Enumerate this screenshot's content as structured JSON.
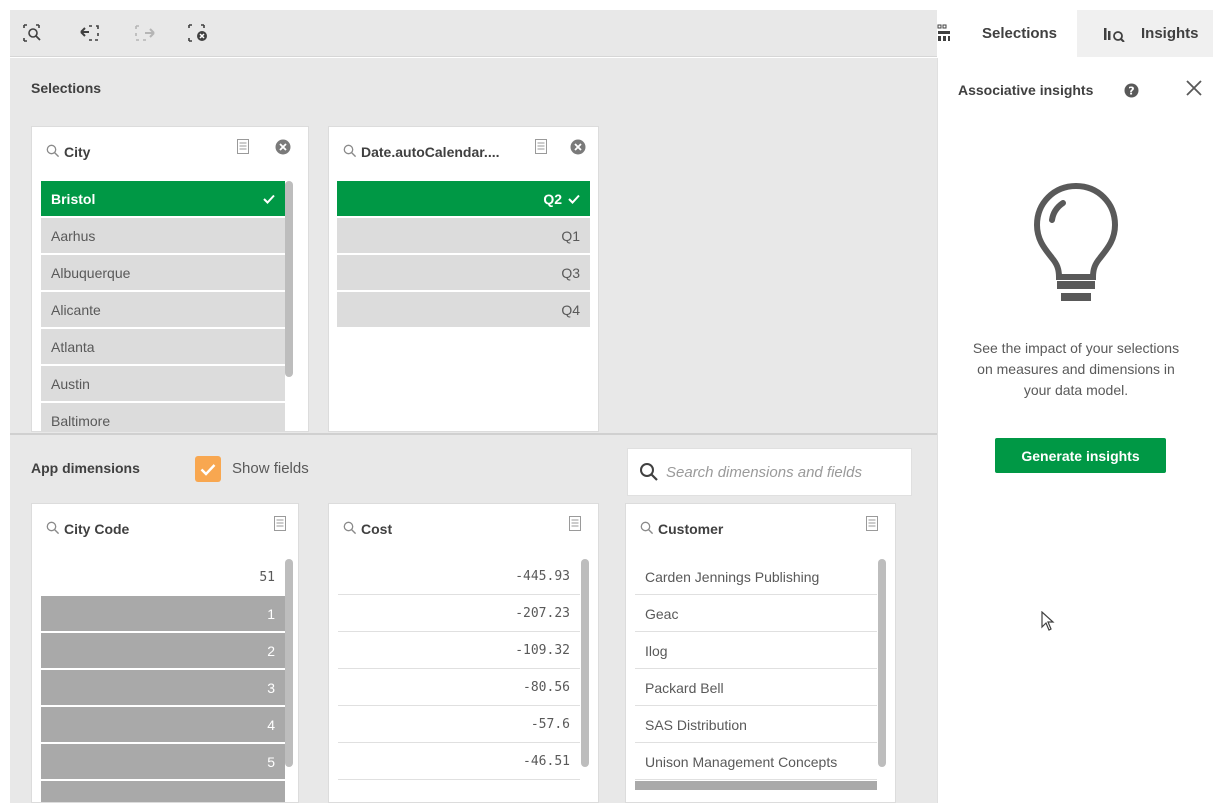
{
  "toolbar": {
    "buttons": [
      "smart-search-icon",
      "step-back-icon",
      "step-forward-icon",
      "clear-all-icon"
    ]
  },
  "tabs": {
    "selections": "Selections",
    "insights": "Insights"
  },
  "selections": {
    "title": "Selections",
    "city": {
      "title": "City",
      "selected": "Bristol",
      "items": [
        "Aarhus",
        "Albuquerque",
        "Alicante",
        "Atlanta",
        "Austin",
        "Baltimore"
      ]
    },
    "date": {
      "title": "Date.autoCalendar....",
      "selected": "Q2",
      "items": [
        "Q1",
        "Q3",
        "Q4"
      ]
    }
  },
  "app_dimensions": {
    "title": "App dimensions",
    "show_fields_label": "Show fields",
    "show_fields_checked": true,
    "search_placeholder": "Search dimensions and fields",
    "city_code": {
      "title": "City Code",
      "first": "51",
      "items": [
        "1",
        "2",
        "3",
        "4",
        "5"
      ]
    },
    "cost": {
      "title": "Cost",
      "items": [
        "-445.93",
        "-207.23",
        "-109.32",
        "-80.56",
        "-57.6",
        "-46.51"
      ]
    },
    "customer": {
      "title": "Customer",
      "items": [
        "Carden Jennings Publishing",
        "Geac",
        "Ilog",
        "Packard Bell",
        "SAS Distribution",
        "Unison Management Concepts"
      ]
    }
  },
  "insights_panel": {
    "title": "Associative insights",
    "description": "See the impact of your selections on measures and dimensions in your data model.",
    "generate_button": "Generate insights"
  },
  "colors": {
    "selected": "#009845",
    "alternative": "#dcdcdc",
    "excluded": "#a9a9a9",
    "checkbox": "#f8a750"
  }
}
